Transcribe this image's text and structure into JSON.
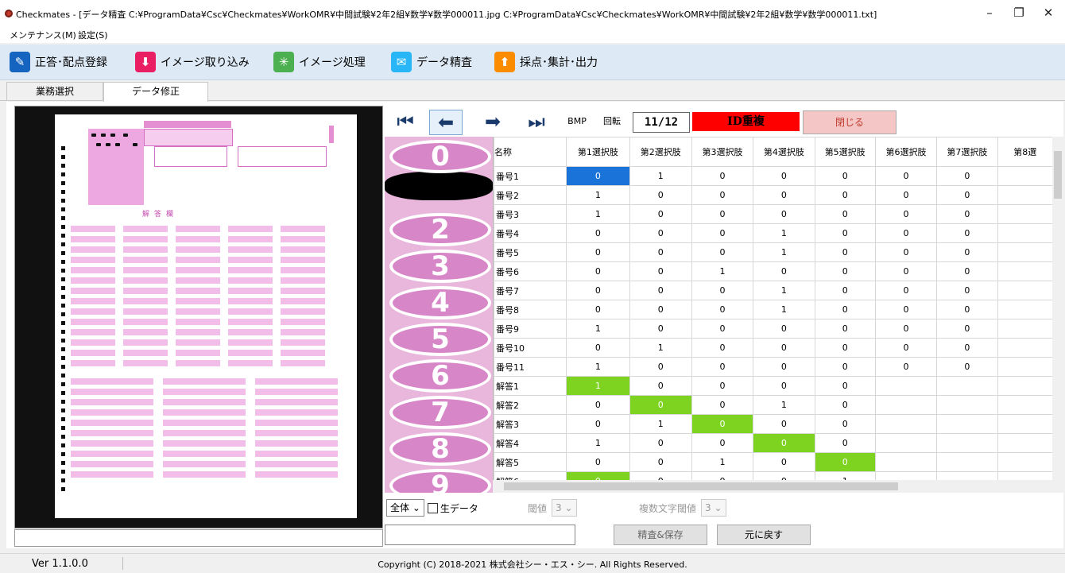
{
  "window": {
    "title": "Checkmates - [データ精査 C:¥ProgramData¥Csc¥Checkmates¥WorkOMR¥中間試験¥2年2組¥数学¥数学000011.jpg C:¥ProgramData¥Csc¥Checkmates¥WorkOMR¥中間試験¥2年2組¥数学¥数学000011.txt]",
    "minimize": "–",
    "restore": "❐",
    "close": "✕"
  },
  "menu": {
    "maintenance": "メンテナンス(M)",
    "settings": "設定(S)"
  },
  "toolbar": {
    "items": [
      {
        "label": "正答･配点登録",
        "icon": "edit-icon",
        "color": "#1565c0",
        "glyph": "✎"
      },
      {
        "label": "イメージ取り込み",
        "icon": "download-icon",
        "color": "#e91e63",
        "glyph": "⬇"
      },
      {
        "label": "イメージ処理",
        "icon": "sparkle-icon",
        "color": "#4caf50",
        "glyph": "✳"
      },
      {
        "label": "データ精査",
        "icon": "check-mail-icon",
        "color": "#29b6f6",
        "glyph": "✉"
      },
      {
        "label": "採点･集計･出力",
        "icon": "upload-icon",
        "color": "#fb8c00",
        "glyph": "⬆"
      }
    ]
  },
  "tabs": {
    "work_select": "業務選択",
    "data_fix": "データ修正"
  },
  "sheet": {
    "answer_heading": "解答欄"
  },
  "controls": {
    "first": "⏮",
    "prev": "⬅",
    "next": "➡",
    "last": "⏭",
    "bmp": "BMP",
    "rotate": "回転",
    "counter": "11/12",
    "status": "ID重複",
    "close": "閉じる"
  },
  "strip": {
    "digits": [
      "0",
      "1",
      "2",
      "3",
      "4",
      "5",
      "6",
      "7",
      "8",
      "9"
    ]
  },
  "grid": {
    "headers": [
      "名称",
      "第1選択肢",
      "第2選択肢",
      "第3選択肢",
      "第4選択肢",
      "第5選択肢",
      "第6選択肢",
      "第7選択肢",
      "第8選"
    ],
    "rows": [
      {
        "name": "番号1",
        "cells": [
          "0",
          "1",
          "0",
          "0",
          "0",
          "0",
          "0",
          ""
        ]
      },
      {
        "name": "番号2",
        "cells": [
          "1",
          "0",
          "0",
          "0",
          "0",
          "0",
          "0",
          ""
        ]
      },
      {
        "name": "番号3",
        "cells": [
          "1",
          "0",
          "0",
          "0",
          "0",
          "0",
          "0",
          ""
        ]
      },
      {
        "name": "番号4",
        "cells": [
          "0",
          "0",
          "0",
          "1",
          "0",
          "0",
          "0",
          ""
        ]
      },
      {
        "name": "番号5",
        "cells": [
          "0",
          "0",
          "0",
          "1",
          "0",
          "0",
          "0",
          ""
        ]
      },
      {
        "name": "番号6",
        "cells": [
          "0",
          "0",
          "1",
          "0",
          "0",
          "0",
          "0",
          ""
        ]
      },
      {
        "name": "番号7",
        "cells": [
          "0",
          "0",
          "0",
          "1",
          "0",
          "0",
          "0",
          ""
        ]
      },
      {
        "name": "番号8",
        "cells": [
          "0",
          "0",
          "0",
          "1",
          "0",
          "0",
          "0",
          ""
        ]
      },
      {
        "name": "番号9",
        "cells": [
          "1",
          "0",
          "0",
          "0",
          "0",
          "0",
          "0",
          ""
        ]
      },
      {
        "name": "番号10",
        "cells": [
          "0",
          "1",
          "0",
          "0",
          "0",
          "0",
          "0",
          ""
        ]
      },
      {
        "name": "番号11",
        "cells": [
          "1",
          "0",
          "0",
          "0",
          "0",
          "0",
          "0",
          ""
        ]
      },
      {
        "name": "解答1",
        "cells": [
          "1",
          "0",
          "0",
          "0",
          "0",
          "",
          "",
          ""
        ]
      },
      {
        "name": "解答2",
        "cells": [
          "0",
          "0",
          "0",
          "1",
          "0",
          "",
          "",
          ""
        ]
      },
      {
        "name": "解答3",
        "cells": [
          "0",
          "1",
          "0",
          "0",
          "0",
          "",
          "",
          ""
        ]
      },
      {
        "name": "解答4",
        "cells": [
          "1",
          "0",
          "0",
          "0",
          "0",
          "",
          "",
          ""
        ]
      },
      {
        "name": "解答5",
        "cells": [
          "0",
          "0",
          "1",
          "0",
          "0",
          "",
          "",
          ""
        ]
      },
      {
        "name": "解答6",
        "cells": [
          "0",
          "0",
          "0",
          "0",
          "1",
          "",
          "",
          ""
        ]
      }
    ],
    "selected": [
      0,
      0
    ],
    "highlights": [
      [
        11,
        0
      ],
      [
        12,
        1
      ],
      [
        13,
        2
      ],
      [
        14,
        3
      ],
      [
        15,
        4
      ],
      [
        16,
        0
      ]
    ],
    "highlight_color": "#7ed321",
    "selected_color": "#1a73d9"
  },
  "bottom": {
    "scope": "全体",
    "raw_data": "生データ",
    "threshold_label": "閾値",
    "threshold_value": "3",
    "multi_threshold_label": "複数文字閾値",
    "multi_threshold_value": "3",
    "save": "精査&保存",
    "revert": "元に戻す"
  },
  "status": {
    "version": "Ver 1.1.0.0",
    "copyright": "Copyright (C) 2018-2021 株式会社シー・エス・シー. All Rights Reserved."
  }
}
